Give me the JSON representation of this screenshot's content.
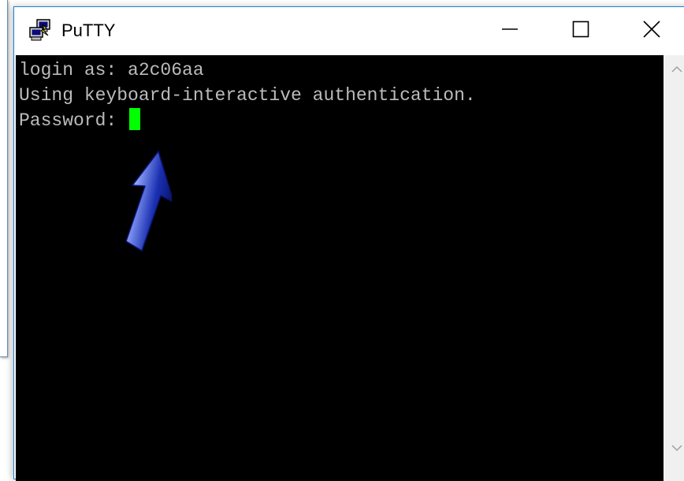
{
  "window": {
    "title": "PuTTY",
    "border_color": "#1883d7",
    "icons": {
      "app": "putty-app-icon",
      "minimize": "minimize-icon",
      "maximize": "maximize-icon",
      "close": "close-icon"
    }
  },
  "terminal": {
    "background": "#000000",
    "text_color": "#bbbbbb",
    "cursor_color": "#00ff00",
    "lines": [
      "login as: a2c06aa",
      "Using keyboard-interactive authentication.",
      "Password: "
    ]
  },
  "annotation": {
    "icon": "blue-arrow-icon",
    "color": "#1a2fb0"
  },
  "scrollbar": {
    "up_icon": "scroll-up-chevron-icon",
    "down_icon": "scroll-down-chevron-icon"
  }
}
